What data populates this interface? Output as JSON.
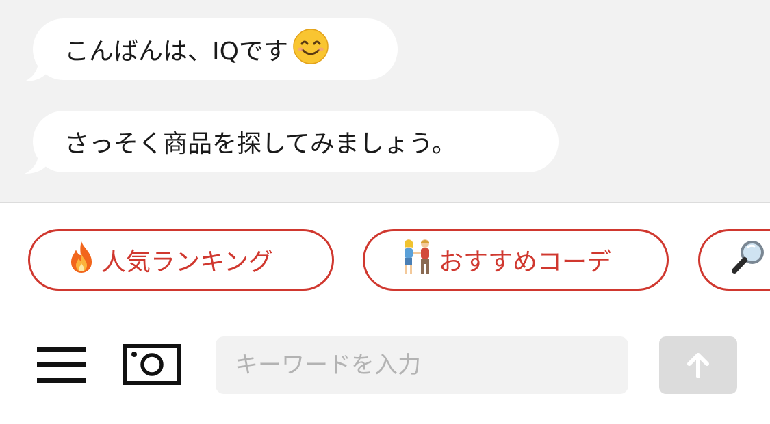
{
  "chat": {
    "messages": [
      {
        "text": "こんばんは、IQです",
        "emoji_icon": "smiling-face-emoji"
      },
      {
        "text": "さっそく商品を探してみましょう。"
      }
    ]
  },
  "suggestions": [
    {
      "icon": "fire-emoji",
      "label": "人気ランキング"
    },
    {
      "icon": "couple-emoji",
      "label": "おすすめコーデ"
    },
    {
      "icon": "magnifier-emoji",
      "label": ""
    }
  ],
  "toolbar": {
    "menu_icon": "hamburger-menu-icon",
    "camera_icon": "camera-icon",
    "search_placeholder": "キーワードを入力",
    "search_value": "",
    "send_icon": "arrow-up-icon"
  },
  "colors": {
    "accent": "#d0382f",
    "chat_background": "#f2f2f2",
    "input_background": "#f2f2f2",
    "send_disabled": "#dcdcdc"
  }
}
